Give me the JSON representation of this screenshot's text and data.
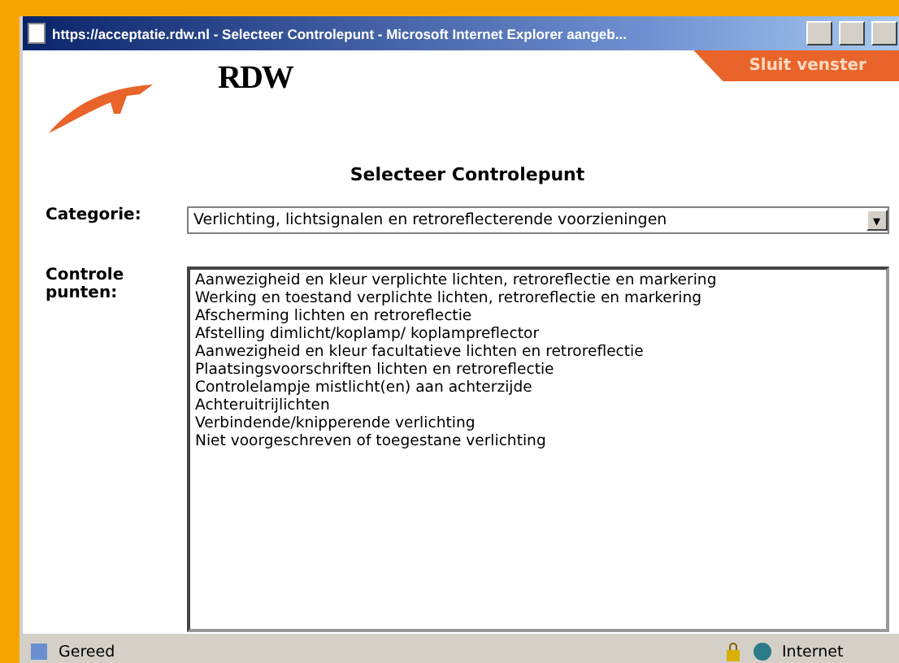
{
  "window": {
    "title": "https://acceptatie.rdw.nl - Selecteer Controlepunt - Microsoft Internet Explorer aangeb..."
  },
  "header": {
    "logo_text": "RDW",
    "close_button": "Sluit venster"
  },
  "heading": "Selecteer Controlepunt",
  "category": {
    "label": "Categorie:",
    "value": "Verlichting, lichtsignalen en retroreflecterende voorzieningen",
    "arrow": "▾"
  },
  "checkpoints": {
    "label": "Controle punten:",
    "items": [
      "Aanwezigheid en kleur verplichte lichten, retroreflectie en markering",
      "Werking en toestand verplichte lichten, retroreflectie en markering",
      "Afscherming lichten en retroreflectie",
      "Afstelling dimlicht/koplamp/ koplampreflector",
      "Aanwezigheid en kleur facultatieve lichten en retroreflectie",
      "Plaatsingsvoorschriften lichten en retroreflectie",
      "Controlelampje mistlicht(en) aan achterzijde",
      "Achteruitrijlichten",
      "Verbindende/knipperende verlichting",
      "Niet voorgeschreven of toegestane verlichting"
    ]
  },
  "status_bar": {
    "status": "Gereed",
    "zone": "Internet"
  }
}
